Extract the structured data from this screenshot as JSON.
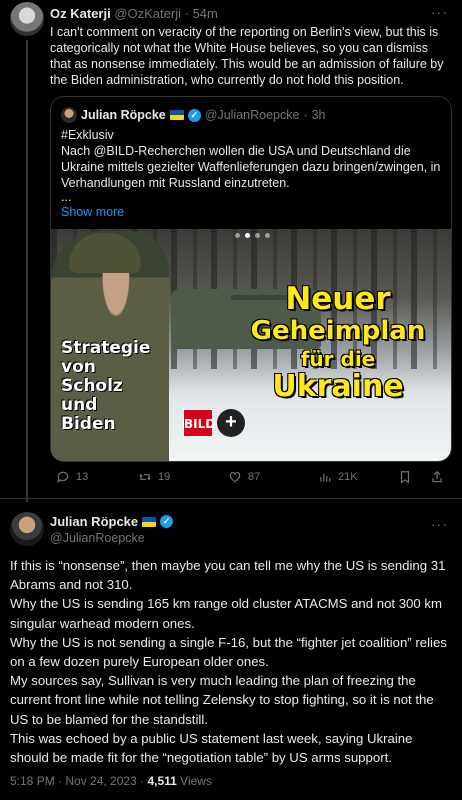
{
  "parent": {
    "author_name": "Oz Katerji",
    "author_handle": "@OzKaterji",
    "time": "54m",
    "more": "···",
    "text": "I can't comment on veracity of the reporting on Berlin's view, but this is categorically not what the White House believes, so you can dismiss that as nonsense immediately. This would be an admission of failure by the Biden administration, who currently do not hold this position.",
    "quote": {
      "author_name": "Julian Röpcke",
      "author_handle": "@JulianRoepcke",
      "time": "3h",
      "hashtag": "#Exklusiv",
      "text": "Nach @BILD-Recherchen wollen die USA und Deutschland die Ukraine mittels gezielter Waffenlieferungen dazu bringen/zwingen, in Verhandlungen mit Russland einzutreten.",
      "ellipsis": "...",
      "show_more": "Show more",
      "media": {
        "headline_1": "Neuer",
        "headline_2": "Geheimplan",
        "headline_3": "für die",
        "headline_4": "Ukraine",
        "side_1": "Strategie",
        "side_2": "von",
        "side_3": "Scholz",
        "side_4": "und",
        "side_5": "Biden",
        "logo": "BILD",
        "plus": "+"
      }
    },
    "actions": {
      "replies": "13",
      "reposts": "19",
      "likes": "87",
      "views": "21K"
    }
  },
  "main": {
    "author_name": "Julian Röpcke",
    "author_handle": "@JulianRoepcke",
    "more": "···",
    "text_lines": [
      "If this is “nonsense”, then maybe you can tell me why the US is sending 31 Abrams and not 310.",
      "Why the US is sending 165 km range old cluster ATACMS and not 300 km singular warhead modern ones.",
      "Why the US is not sending a single F-16, but the “fighter jet coalition” relies on a few dozen purely European older ones.",
      "My sources say, Sullivan is very much leading the plan of freezing the current front line while not telling Zelensky to stop fighting, so it is not the US to be blamed for the standstill.",
      "This was echoed by a public US statement last week, saying Ukraine should be made fit for the “negotiation table” by US arms support."
    ],
    "timestamp": "5:18 PM · Nov 24, 2023",
    "dot": "·",
    "views_count": "4,511",
    "views_label": "Views"
  }
}
